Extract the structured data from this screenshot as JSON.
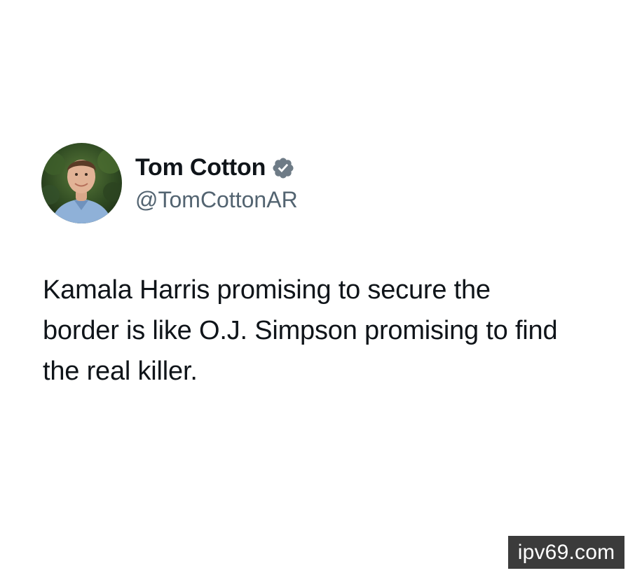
{
  "post": {
    "author": {
      "display_name": "Tom Cotton",
      "handle": "@TomCottonAR",
      "verified": true,
      "verified_color": "#6e7b86",
      "avatar_icon": "profile-photo"
    },
    "text_lines": [
      "Kamala Harris promising to secure the",
      "border is like O.J. Simpson promising to find",
      "the real killer."
    ]
  },
  "watermark": {
    "text": "ipv69.com"
  },
  "colors": {
    "background": "#ffffff",
    "text_primary": "#0f1419",
    "text_secondary": "#536471",
    "watermark_bg": "#3b3b3b"
  }
}
